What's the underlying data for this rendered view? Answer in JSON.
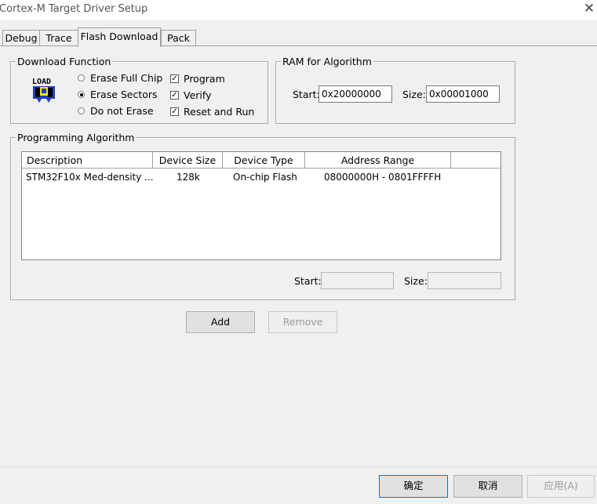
{
  "window": {
    "title": "Cortex-M Target Driver Setup"
  },
  "tabs": [
    {
      "label": "Debug"
    },
    {
      "label": "Trace"
    },
    {
      "label": "Flash Download",
      "active": true
    },
    {
      "label": "Pack"
    }
  ],
  "download_function": {
    "legend": "Download Function",
    "icon_text": "LOAD",
    "radios": [
      {
        "label": "Erase Full Chip",
        "selected": false
      },
      {
        "label": "Erase Sectors",
        "selected": true
      },
      {
        "label": "Do not Erase",
        "selected": false
      }
    ],
    "checks": [
      {
        "label": "Program",
        "checked": true
      },
      {
        "label": "Verify",
        "checked": true
      },
      {
        "label": "Reset and Run",
        "checked": true
      }
    ]
  },
  "ram": {
    "legend": "RAM for Algorithm",
    "start_label": "Start:",
    "start_value": "0x20000000",
    "size_label": "Size:",
    "size_value": "0x00001000"
  },
  "programming": {
    "legend": "Programming Algorithm",
    "columns": [
      "Description",
      "Device Size",
      "Device Type",
      "Address Range"
    ],
    "rows": [
      [
        "STM32F10x Med-density ...",
        "128k",
        "On-chip Flash",
        "08000000H - 0801FFFFH"
      ]
    ],
    "start_label": "Start:",
    "start_value": "",
    "size_label": "Size:",
    "size_value": ""
  },
  "actions": {
    "add": "Add",
    "remove": "Remove"
  },
  "footer": {
    "ok": "确定",
    "cancel": "取消",
    "apply": "应用(A)"
  },
  "colors": {
    "accent": "#0078d7",
    "window_bg": "#f0f0f0",
    "icon_blue": "#1f3fbf",
    "icon_yellow": "#f6e600"
  }
}
